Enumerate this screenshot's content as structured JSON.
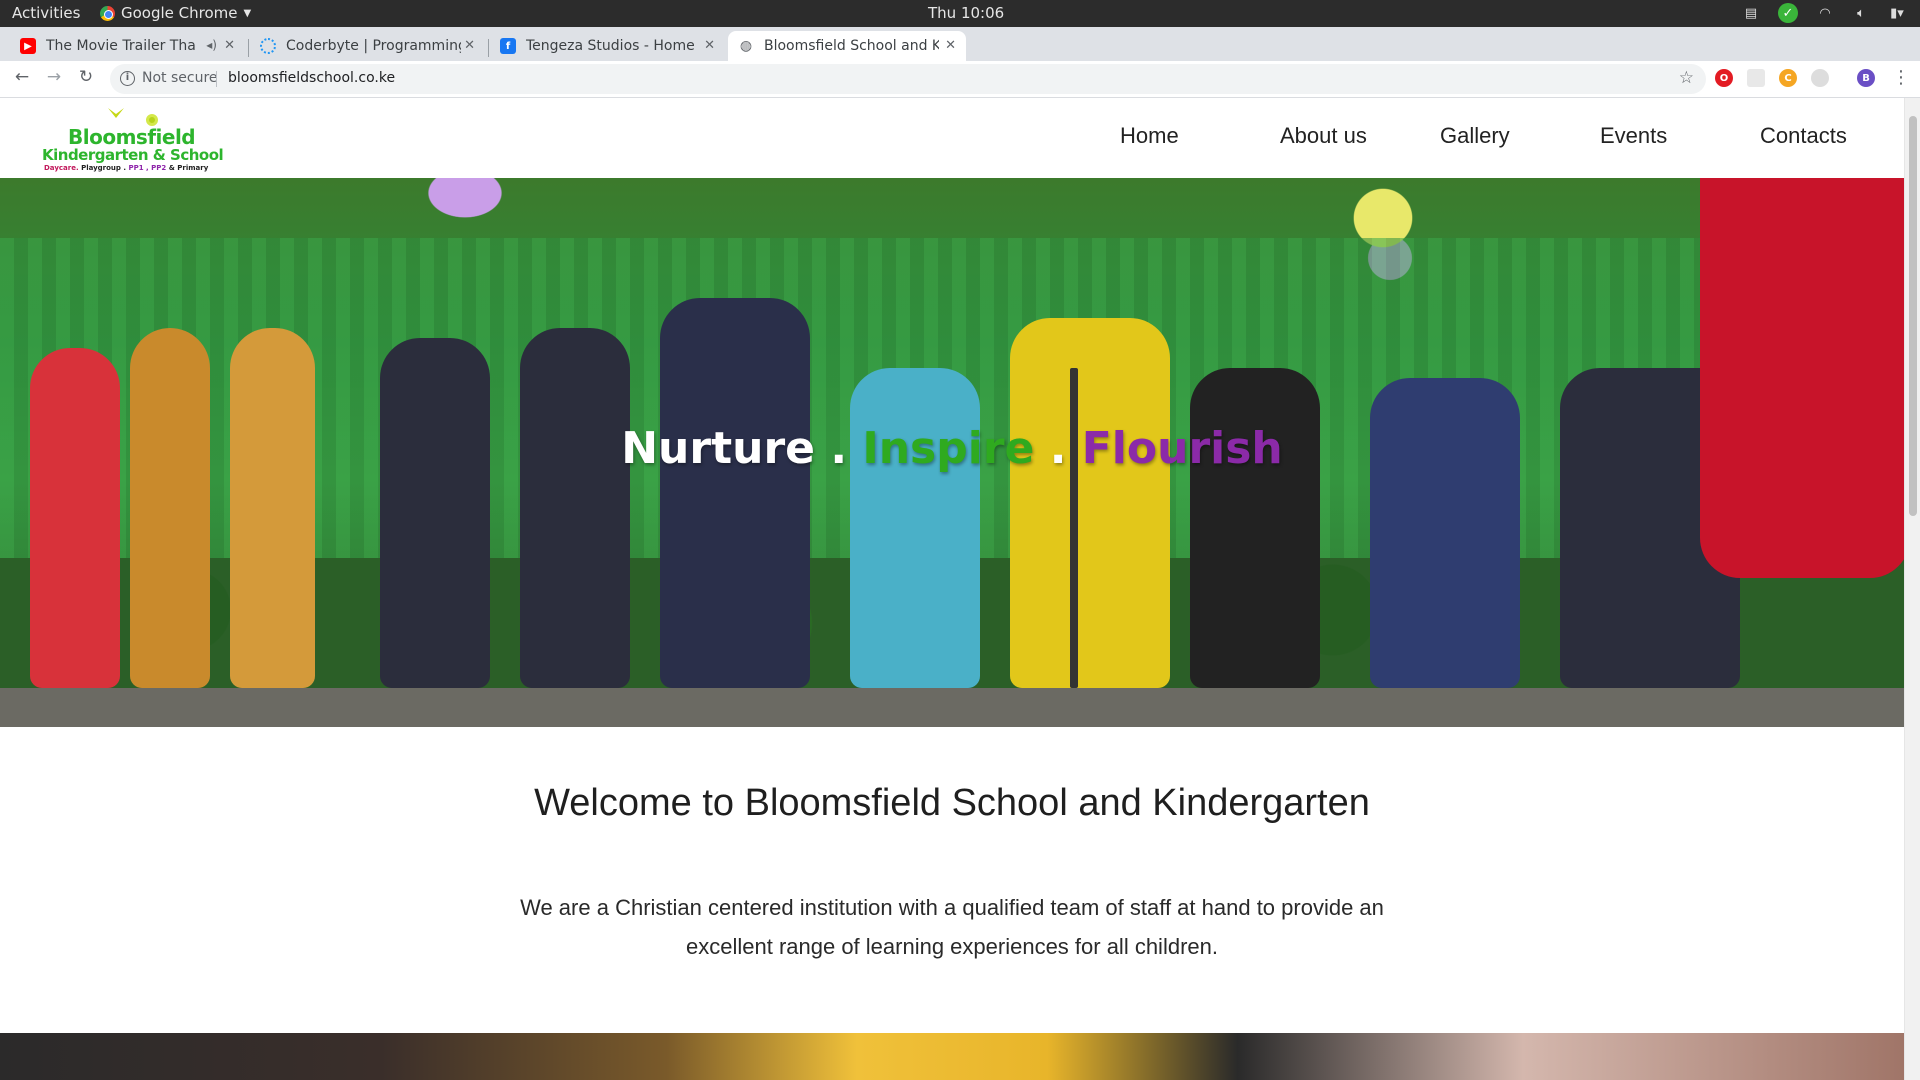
{
  "os": {
    "activities": "Activities",
    "app_menu": "Google Chrome",
    "clock": "Thu 10:06"
  },
  "tabs": [
    {
      "title": "The Movie Trailer That",
      "favicon": "youtube-icon",
      "color": "#ff0000"
    },
    {
      "title": "Coderbyte | Programming",
      "favicon": "loading-icon",
      "color": "#2196f3"
    },
    {
      "title": "Tengeza Studios - Home",
      "favicon": "facebook-icon",
      "color": "#1877f2"
    },
    {
      "title": "Bloomsfield School and K",
      "favicon": "globe-icon",
      "color": "#5f6368"
    }
  ],
  "omnibox": {
    "security": "Not secure",
    "url": "bloomsfieldschool.co.ke"
  },
  "profile_initial": "B",
  "logo": {
    "line1": "Bloomsfield",
    "line2": "Kindergarten & School",
    "tag_daycare": "Daycare.",
    "tag_playgroup": "Playgroup .",
    "tag_pp": "PP1 , PP2",
    "tag_primary": "& Primary"
  },
  "nav": [
    "Home",
    "About us",
    "Gallery",
    "Events",
    "Contacts"
  ],
  "hero": {
    "word1": "Nurture",
    "sep1": ".",
    "word2": "Inspire",
    "sep2": ".",
    "word3": "Flourish",
    "colors": {
      "word1": "#ffffff",
      "word2": "#2faa1f",
      "word3": "#8b2aa8"
    }
  },
  "welcome_title": "Welcome to Bloomsfield School and Kindergarten",
  "intro_text": "We are a Christian centered institution with a qualified team of staff at hand to provide an excellent range of learning experiences for all children."
}
